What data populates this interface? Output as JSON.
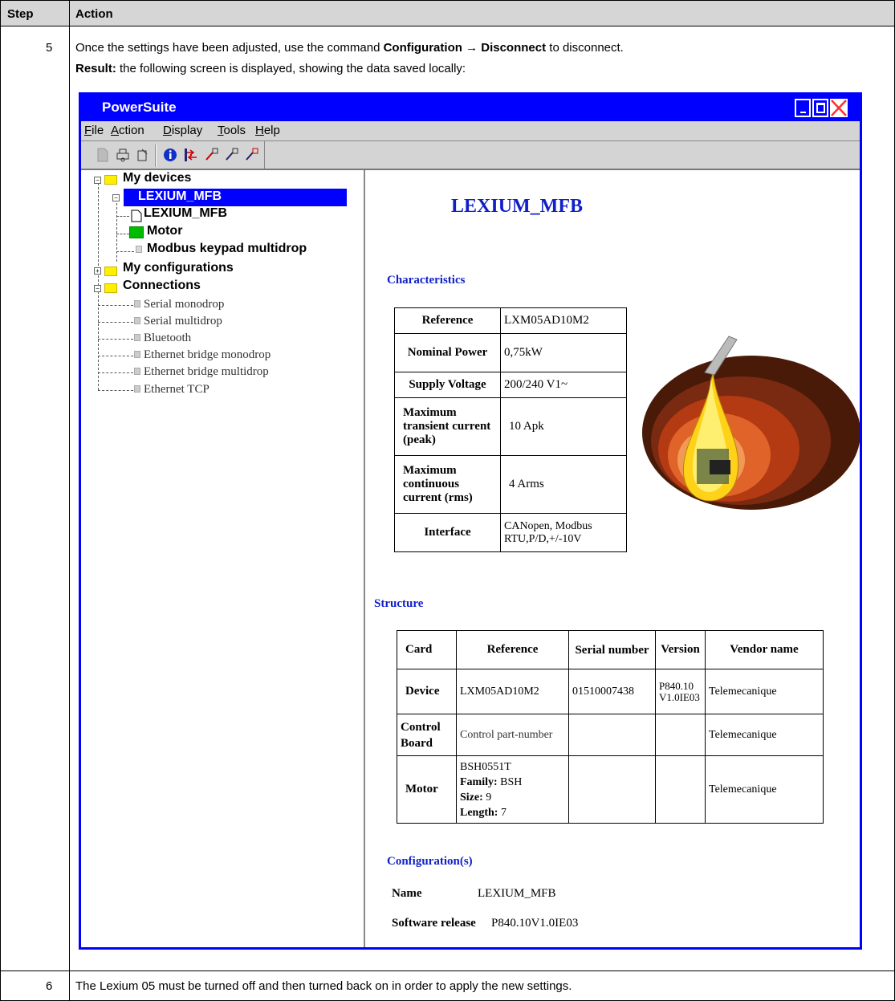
{
  "table_header": {
    "step": "Step",
    "action": "Action"
  },
  "row5": {
    "step": "5",
    "line1_pre": "Once the settings have been adjusted, use the command ",
    "line1_cmd1": "Configuration",
    "line1_arrow": " → ",
    "line1_cmd2": "Disconnect",
    "line1_post": " to disconnect.",
    "result_label": "Result:",
    "result_text": " the following screen is displayed, showing the data saved locally:"
  },
  "row6": {
    "step": "6",
    "text": "The Lexium 05 must be turned off and then turned back on in order to apply the new settings."
  },
  "window": {
    "title": "PowerSuite",
    "menu": [
      {
        "key": "F",
        "rest": "ile"
      },
      {
        "key": "A",
        "rest": "ction"
      },
      {
        "key": "D",
        "rest": "isplay"
      },
      {
        "key": "T",
        "rest": "ools"
      },
      {
        "key": "H",
        "rest": "elp"
      }
    ]
  },
  "tree": {
    "my_devices": "My devices",
    "device_selected": "LEXIUM_MFB",
    "doc_item": "LEXIUM_MFB",
    "motor": "Motor",
    "modbus": "Modbus keypad multidrop",
    "my_configurations": "My configurations",
    "connections": "Connections",
    "connection_items": [
      "Serial monodrop",
      "Serial multidrop",
      "Bluetooth",
      "Ethernet bridge monodrop",
      "Ethernet bridge multidrop",
      "Ethernet TCP"
    ]
  },
  "content": {
    "title": "LEXIUM_MFB",
    "characteristics_heading": "Characteristics",
    "characteristics": [
      {
        "label": "Reference",
        "value": "LXM05AD10M2"
      },
      {
        "label": "Nominal Power",
        "value": "0,75kW"
      },
      {
        "label": "Supply Voltage",
        "value": "200/240 V1~"
      },
      {
        "label": "Maximum transient current (peak)",
        "value": "10 Apk"
      },
      {
        "label": "Maximum continuous current (rms)",
        "value": "4 Arms"
      },
      {
        "label": "Interface",
        "value": "CANopen, Modbus RTU,P/D,+/-10V"
      }
    ],
    "structure_heading": "Structure",
    "structure_headers": [
      "Card",
      "Reference",
      "Serial number",
      "Version",
      "Vendor name"
    ],
    "structure_rows": {
      "device": {
        "card": "Device",
        "reference": "LXM05AD10M2",
        "serial": "01510007438",
        "version": "P840.10 V1.0IE03",
        "vendor": "Telemecanique"
      },
      "control": {
        "card": "Control Board",
        "reference": "Control part-number",
        "serial": "",
        "version": "",
        "vendor": "Telemecanique"
      },
      "motor": {
        "card": "Motor",
        "reference": "BSH0551T",
        "family_label": "Family:",
        "family": " BSH",
        "size_label": "Size:",
        "size": " 9",
        "length_label": "Length:",
        "length": " 7",
        "serial": "",
        "version": "",
        "vendor": "Telemecanique"
      }
    },
    "configuration_heading": "Configuration(s)",
    "name_label": "Name",
    "name_value": "LEXIUM_MFB",
    "sw_label": "Software release",
    "sw_value": "P840.10V1.0IE03"
  }
}
